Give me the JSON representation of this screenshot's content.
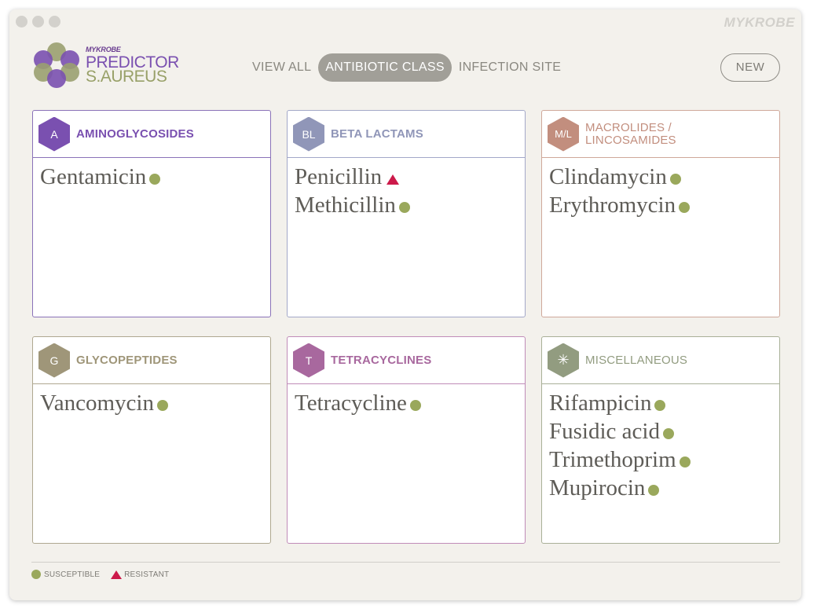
{
  "window": {
    "brand": "MYKROBE"
  },
  "logo": {
    "small": "MYKROBE",
    "line1": "PREDICTOR",
    "line2": "S.AUREUS"
  },
  "nav": {
    "view_all": "VIEW ALL",
    "antibiotic_class": "ANTIBIOTIC CLASS",
    "infection_site": "INFECTION SITE",
    "active": "ANTIBIOTIC CLASS"
  },
  "new_button": "NEW",
  "panels": [
    {
      "badge": "A",
      "title": "AMINOGLYCOSIDES",
      "color": "#7a50b0",
      "border": "#8a72b8",
      "drugs": [
        {
          "name": "Gentamicin",
          "status": "susceptible"
        }
      ]
    },
    {
      "badge": "BL",
      "title": "BETA LACTAMS",
      "color": "#9096b8",
      "border": "#a3a8c8",
      "drugs": [
        {
          "name": "Penicillin",
          "status": "resistant"
        },
        {
          "name": "Methicillin",
          "status": "susceptible"
        }
      ]
    },
    {
      "badge": "M/L",
      "title_line1": "MACROLIDES /",
      "title_line2": "LINCOSAMIDES",
      "color": "#c28e7e",
      "border": "#cfa89a",
      "drugs": [
        {
          "name": "Clindamycin",
          "status": "susceptible"
        },
        {
          "name": "Erythromycin",
          "status": "susceptible"
        }
      ]
    },
    {
      "badge": "G",
      "title": "GLYCOPEPTIDES",
      "color": "#9f9679",
      "border": "#afa890",
      "drugs": [
        {
          "name": "Vancomycin",
          "status": "susceptible"
        }
      ]
    },
    {
      "badge": "T",
      "title": "TETRACYCLINES",
      "color": "#a8689e",
      "border": "#c08cb8",
      "drugs": [
        {
          "name": "Tetracycline",
          "status": "susceptible"
        }
      ]
    },
    {
      "badge": "✳",
      "title": "MISCELLANEOUS",
      "color": "#929c80",
      "border": "#a9b098",
      "drugs": [
        {
          "name": "Rifampicin",
          "status": "susceptible"
        },
        {
          "name": "Fusidic acid",
          "status": "susceptible"
        },
        {
          "name": "Trimethoprim",
          "status": "susceptible"
        },
        {
          "name": "Mupirocin",
          "status": "susceptible"
        }
      ]
    }
  ],
  "legend": {
    "susceptible": "SUSCEPTIBLE",
    "resistant": "RESISTANT"
  },
  "colors": {
    "susceptible": "#9aa85c",
    "resistant": "#cc1a4a",
    "background": "#f3f1ec"
  }
}
